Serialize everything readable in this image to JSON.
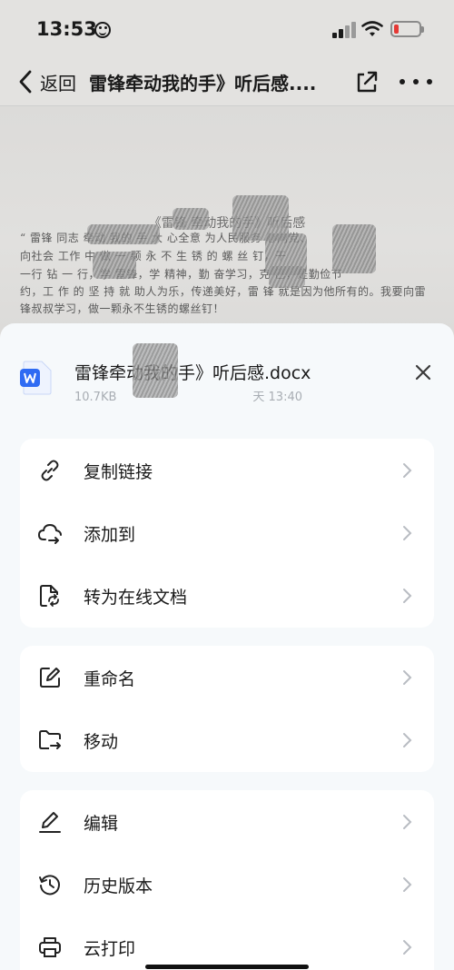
{
  "status_bar": {
    "time": "13:53"
  },
  "nav": {
    "back_label": "返回",
    "title": "雷锋牵动我的手》听后感...."
  },
  "document_preview": {
    "heading": "《雷锋 牵动我的手》听后感",
    "lines": [
      "“ 雷锋 同志 牵动 我的 手 大 心全意 为人民服务   心向党、",
      "向社会 工作 中 做 一 颗 永 不 生 锈 的 螺 丝 钉，干",
      "一行 钻 一 行，学 雷锋，学 精神，勤 奋学习，克 己，是勤俭节",
      "约，工 作 的 坚 持 就 助人为乐，传递美好，雷 锋 就是因为他所有的。我要向雷",
      "锋叔叔学习，做一颗永不生锈的螺丝钉！"
    ]
  },
  "sheet": {
    "file_name": "雷锋牵动我的手》听后感.docx",
    "file_size": "10.7KB",
    "file_time": "天 13:40",
    "groups": [
      {
        "items": [
          {
            "label": "复制链接",
            "icon": "link-icon"
          },
          {
            "label": "添加到",
            "icon": "cloud-add-icon"
          },
          {
            "label": "转为在线文档",
            "icon": "convert-doc-icon"
          }
        ]
      },
      {
        "items": [
          {
            "label": "重命名",
            "icon": "rename-icon"
          },
          {
            "label": "移动",
            "icon": "move-folder-icon"
          }
        ]
      },
      {
        "items": [
          {
            "label": "编辑",
            "icon": "edit-pen-icon"
          },
          {
            "label": "历史版本",
            "icon": "history-icon"
          },
          {
            "label": "云打印",
            "icon": "printer-icon"
          }
        ]
      }
    ]
  },
  "colors": {
    "accent_doc_icon": "#2f6bf3",
    "battery_low": "#e53935",
    "sheet_bg": "#f6f9fb"
  }
}
